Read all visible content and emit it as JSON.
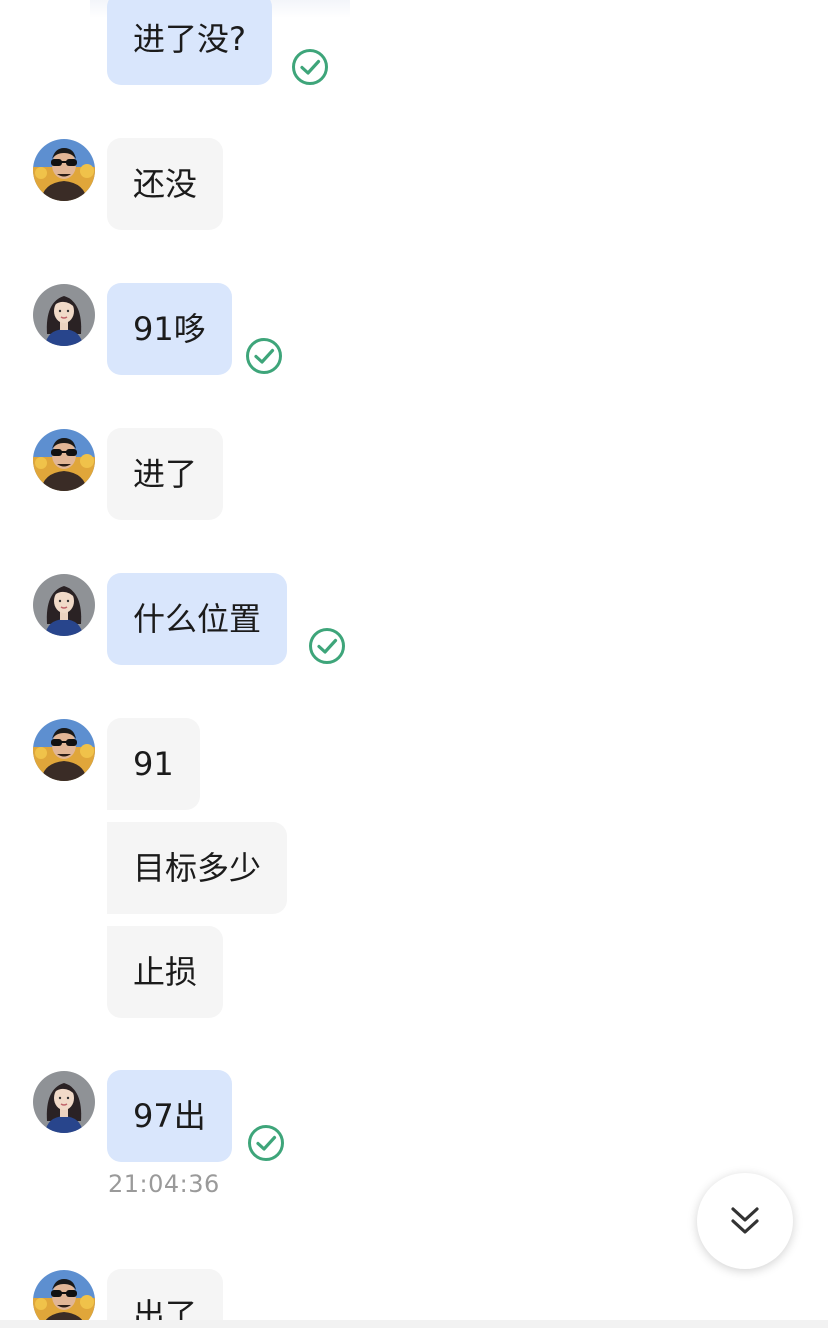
{
  "messages": [
    {
      "id": 1,
      "sender": "me",
      "text": "进了没?",
      "status": "read-check-icon"
    },
    {
      "id": 2,
      "sender": "other",
      "text": "还没"
    },
    {
      "id": 3,
      "sender": "me",
      "text": "91哆",
      "status": "read-check-icon"
    },
    {
      "id": 4,
      "sender": "other",
      "text": "进了"
    },
    {
      "id": 5,
      "sender": "me",
      "text": "什么位置",
      "status": "read-check-icon"
    },
    {
      "id": 6,
      "sender": "other",
      "text": "91"
    },
    {
      "id": 7,
      "sender": "other",
      "text": "目标多少"
    },
    {
      "id": 8,
      "sender": "other",
      "text": "止损"
    },
    {
      "id": 9,
      "sender": "me",
      "text": "97出",
      "status": "read-check-icon",
      "time": "21:04:36"
    },
    {
      "id": 10,
      "sender": "other",
      "text": "出了"
    }
  ],
  "scroll_button": {
    "icon": "double-chevron-down-icon"
  },
  "colors": {
    "my_bubble": "#d9e6fc",
    "their_bubble": "#f5f5f5",
    "check": "#3ea57a",
    "timestamp": "#9a9a9a"
  }
}
